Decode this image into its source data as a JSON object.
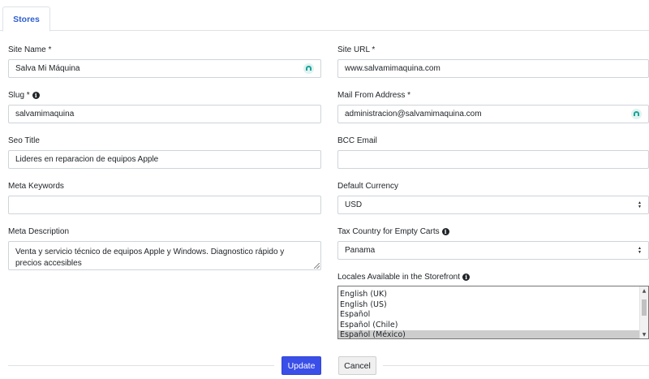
{
  "tabs": [
    {
      "label": "Stores",
      "active": true
    }
  ],
  "left": {
    "site_name": {
      "label": "Site Name *",
      "value": "Salva Mi Máquina"
    },
    "slug": {
      "label": "Slug *",
      "value": "salvamimaquina"
    },
    "seo_title": {
      "label": "Seo Title",
      "value": "Lideres en reparacion de equipos Apple"
    },
    "meta_keywords": {
      "label": "Meta Keywords",
      "value": ""
    },
    "meta_description": {
      "label": "Meta Description",
      "line1": "Venta y servicio técnico de equipos Apple y Windows. Diagnostico rápido y",
      "line2": "precios accesibles"
    }
  },
  "right": {
    "site_url": {
      "label": "Site URL *",
      "value": "www.salvamimaquina.com"
    },
    "mail_from": {
      "label": "Mail From Address *",
      "value": "administracion@salvamimaquina.com"
    },
    "bcc_email": {
      "label": "BCC Email",
      "value": ""
    },
    "default_currency": {
      "label": "Default Currency",
      "value": "USD"
    },
    "tax_country": {
      "label": "Tax Country for Empty Carts",
      "value": "Panama"
    },
    "locales": {
      "label": "Locales Available in the Storefront",
      "options": [
        "English (UK)",
        "English (US)",
        "Español",
        "Español (Chile)",
        "Español (México)"
      ],
      "selected": "Español (México)"
    }
  },
  "actions": {
    "update": "Update",
    "cancel": "Cancel"
  },
  "colors": {
    "accent": "#3a4ee8",
    "tab_text": "#2f5fd0",
    "password_icon": "#18a39a"
  },
  "icons": {
    "info": "info-circle-icon",
    "password_manager": "password-manager-icon"
  }
}
